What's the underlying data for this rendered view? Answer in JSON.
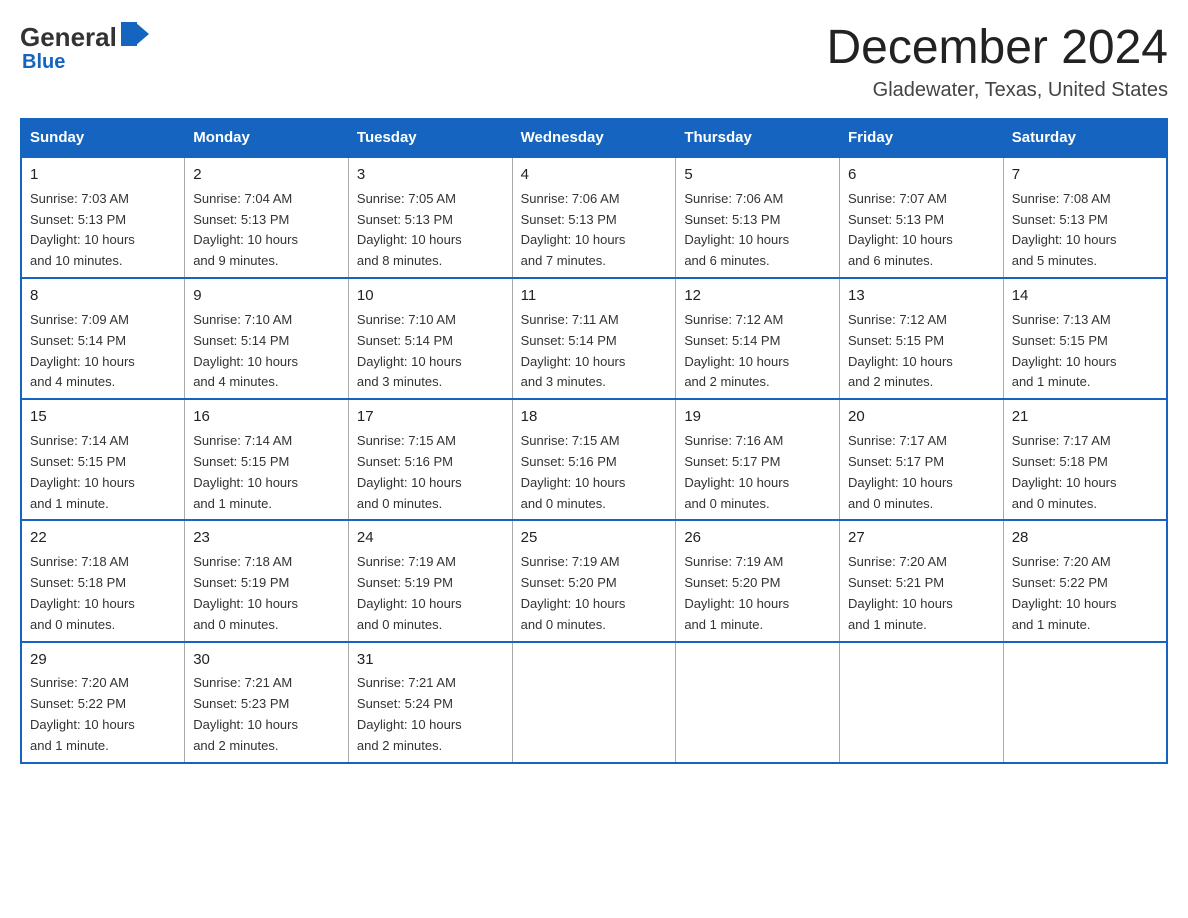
{
  "header": {
    "logo_general": "General",
    "logo_blue": "Blue",
    "title": "December 2024",
    "subtitle": "Gladewater, Texas, United States"
  },
  "days_of_week": [
    "Sunday",
    "Monday",
    "Tuesday",
    "Wednesday",
    "Thursday",
    "Friday",
    "Saturday"
  ],
  "weeks": [
    [
      {
        "day": "1",
        "sunrise": "7:03 AM",
        "sunset": "5:13 PM",
        "daylight": "10 hours and 10 minutes."
      },
      {
        "day": "2",
        "sunrise": "7:04 AM",
        "sunset": "5:13 PM",
        "daylight": "10 hours and 9 minutes."
      },
      {
        "day": "3",
        "sunrise": "7:05 AM",
        "sunset": "5:13 PM",
        "daylight": "10 hours and 8 minutes."
      },
      {
        "day": "4",
        "sunrise": "7:06 AM",
        "sunset": "5:13 PM",
        "daylight": "10 hours and 7 minutes."
      },
      {
        "day": "5",
        "sunrise": "7:06 AM",
        "sunset": "5:13 PM",
        "daylight": "10 hours and 6 minutes."
      },
      {
        "day": "6",
        "sunrise": "7:07 AM",
        "sunset": "5:13 PM",
        "daylight": "10 hours and 6 minutes."
      },
      {
        "day": "7",
        "sunrise": "7:08 AM",
        "sunset": "5:13 PM",
        "daylight": "10 hours and 5 minutes."
      }
    ],
    [
      {
        "day": "8",
        "sunrise": "7:09 AM",
        "sunset": "5:14 PM",
        "daylight": "10 hours and 4 minutes."
      },
      {
        "day": "9",
        "sunrise": "7:10 AM",
        "sunset": "5:14 PM",
        "daylight": "10 hours and 4 minutes."
      },
      {
        "day": "10",
        "sunrise": "7:10 AM",
        "sunset": "5:14 PM",
        "daylight": "10 hours and 3 minutes."
      },
      {
        "day": "11",
        "sunrise": "7:11 AM",
        "sunset": "5:14 PM",
        "daylight": "10 hours and 3 minutes."
      },
      {
        "day": "12",
        "sunrise": "7:12 AM",
        "sunset": "5:14 PM",
        "daylight": "10 hours and 2 minutes."
      },
      {
        "day": "13",
        "sunrise": "7:12 AM",
        "sunset": "5:15 PM",
        "daylight": "10 hours and 2 minutes."
      },
      {
        "day": "14",
        "sunrise": "7:13 AM",
        "sunset": "5:15 PM",
        "daylight": "10 hours and 1 minute."
      }
    ],
    [
      {
        "day": "15",
        "sunrise": "7:14 AM",
        "sunset": "5:15 PM",
        "daylight": "10 hours and 1 minute."
      },
      {
        "day": "16",
        "sunrise": "7:14 AM",
        "sunset": "5:15 PM",
        "daylight": "10 hours and 1 minute."
      },
      {
        "day": "17",
        "sunrise": "7:15 AM",
        "sunset": "5:16 PM",
        "daylight": "10 hours and 0 minutes."
      },
      {
        "day": "18",
        "sunrise": "7:15 AM",
        "sunset": "5:16 PM",
        "daylight": "10 hours and 0 minutes."
      },
      {
        "day": "19",
        "sunrise": "7:16 AM",
        "sunset": "5:17 PM",
        "daylight": "10 hours and 0 minutes."
      },
      {
        "day": "20",
        "sunrise": "7:17 AM",
        "sunset": "5:17 PM",
        "daylight": "10 hours and 0 minutes."
      },
      {
        "day": "21",
        "sunrise": "7:17 AM",
        "sunset": "5:18 PM",
        "daylight": "10 hours and 0 minutes."
      }
    ],
    [
      {
        "day": "22",
        "sunrise": "7:18 AM",
        "sunset": "5:18 PM",
        "daylight": "10 hours and 0 minutes."
      },
      {
        "day": "23",
        "sunrise": "7:18 AM",
        "sunset": "5:19 PM",
        "daylight": "10 hours and 0 minutes."
      },
      {
        "day": "24",
        "sunrise": "7:19 AM",
        "sunset": "5:19 PM",
        "daylight": "10 hours and 0 minutes."
      },
      {
        "day": "25",
        "sunrise": "7:19 AM",
        "sunset": "5:20 PM",
        "daylight": "10 hours and 0 minutes."
      },
      {
        "day": "26",
        "sunrise": "7:19 AM",
        "sunset": "5:20 PM",
        "daylight": "10 hours and 1 minute."
      },
      {
        "day": "27",
        "sunrise": "7:20 AM",
        "sunset": "5:21 PM",
        "daylight": "10 hours and 1 minute."
      },
      {
        "day": "28",
        "sunrise": "7:20 AM",
        "sunset": "5:22 PM",
        "daylight": "10 hours and 1 minute."
      }
    ],
    [
      {
        "day": "29",
        "sunrise": "7:20 AM",
        "sunset": "5:22 PM",
        "daylight": "10 hours and 1 minute."
      },
      {
        "day": "30",
        "sunrise": "7:21 AM",
        "sunset": "5:23 PM",
        "daylight": "10 hours and 2 minutes."
      },
      {
        "day": "31",
        "sunrise": "7:21 AM",
        "sunset": "5:24 PM",
        "daylight": "10 hours and 2 minutes."
      },
      null,
      null,
      null,
      null
    ]
  ],
  "labels": {
    "sunrise": "Sunrise:",
    "sunset": "Sunset:",
    "daylight": "Daylight:"
  }
}
